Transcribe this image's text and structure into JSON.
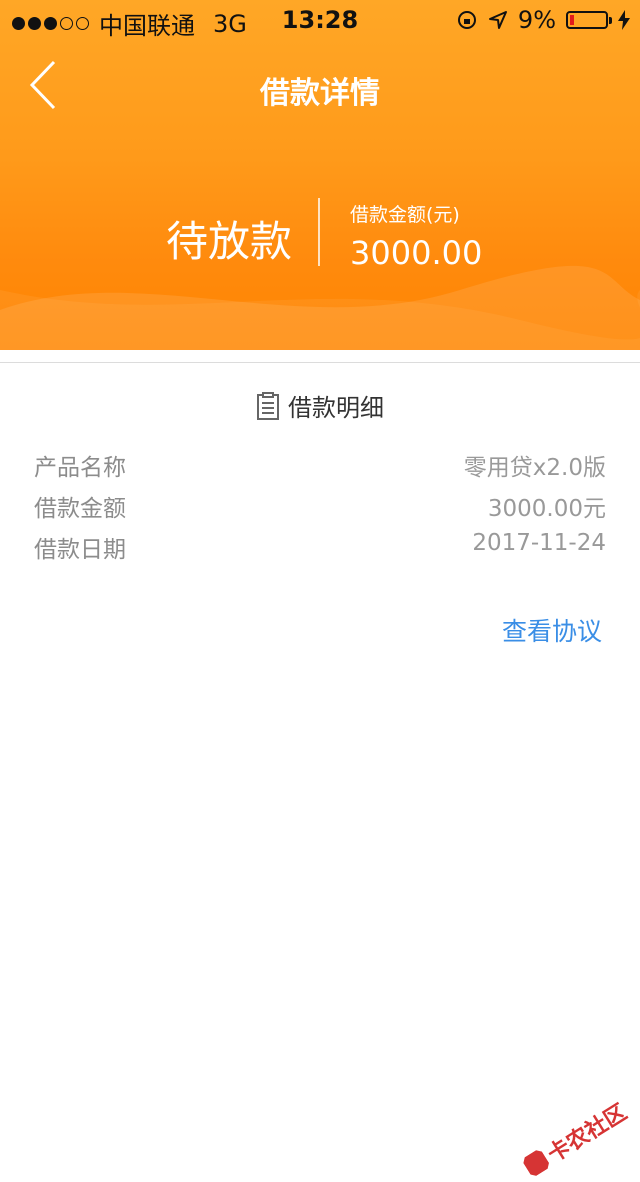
{
  "status_bar": {
    "carrier": "中国联通",
    "network": "3G",
    "time": "13:28",
    "battery_percent": "9%",
    "battery_level": 0.09,
    "signal_bars_filled": 3,
    "signal_bars_total": 5
  },
  "nav": {
    "title": "借款详情",
    "back_icon": "chevron-left-icon"
  },
  "summary": {
    "status": "待放款",
    "amount_label": "借款金额(元)",
    "amount_value": "3000.00"
  },
  "details": {
    "title": "借款明细",
    "icon": "clipboard-icon",
    "rows": [
      {
        "label": "产品名称",
        "value": "零用贷x2.0版"
      },
      {
        "label": "借款金额",
        "value": "3000.00元"
      },
      {
        "label": "借款日期",
        "value": "2017-11-24"
      }
    ]
  },
  "links": {
    "view_agreement": "查看协议"
  },
  "watermark": {
    "text": "卡农社区"
  },
  "colors": {
    "header_orange": "#ff8c00",
    "link_blue": "#3a8ee6",
    "battery_red": "#e21b1b"
  }
}
